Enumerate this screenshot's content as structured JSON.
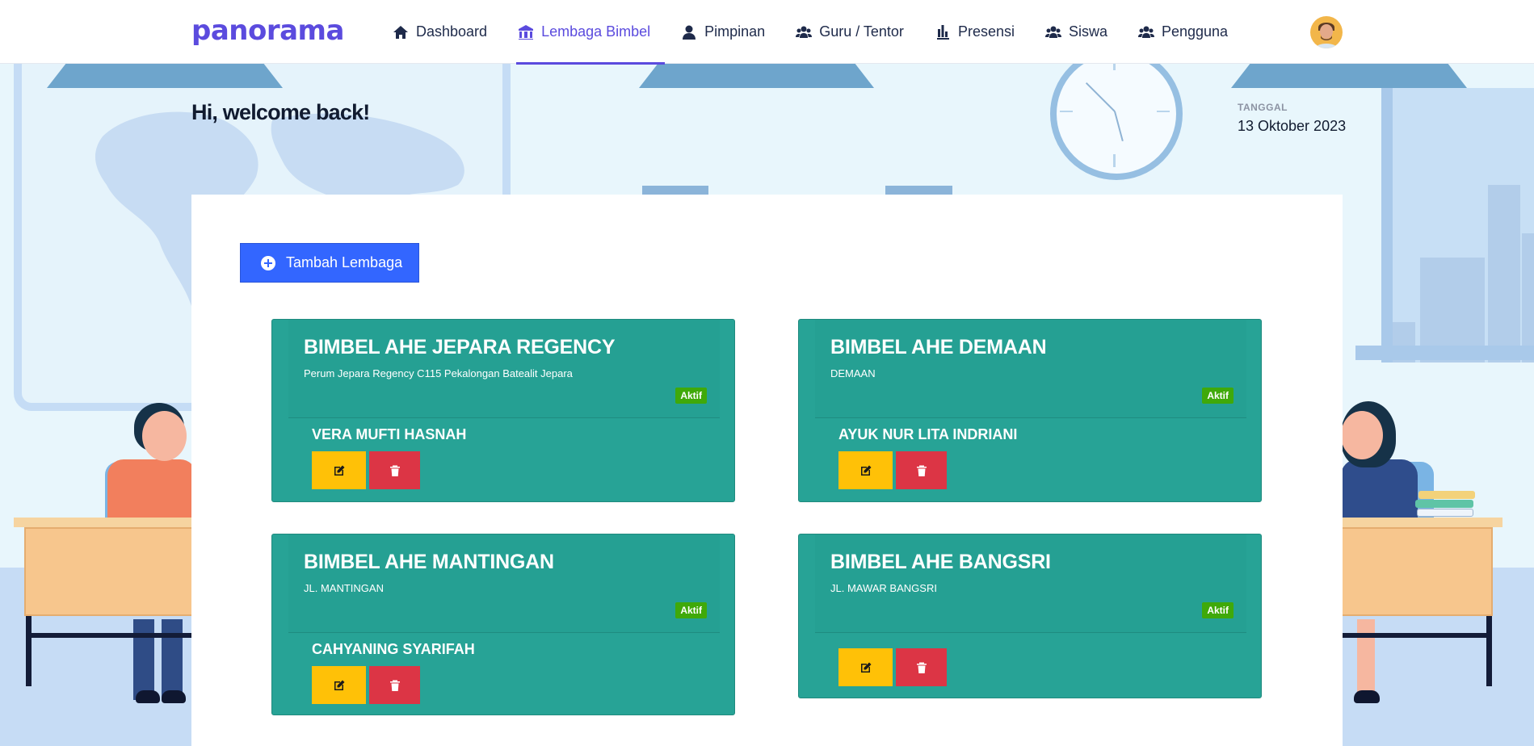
{
  "brand": "panorama",
  "nav": {
    "items": [
      {
        "label": "Dashboard",
        "icon": "home-icon"
      },
      {
        "label": "Lembaga Bimbel",
        "icon": "institution-icon",
        "active": true
      },
      {
        "label": "Pimpinan",
        "icon": "user-icon"
      },
      {
        "label": "Guru / Tentor",
        "icon": "users-icon"
      },
      {
        "label": "Presensi",
        "icon": "attendance-icon"
      },
      {
        "label": "Siswa",
        "icon": "users-icon"
      },
      {
        "label": "Pengguna",
        "icon": "users-icon"
      }
    ]
  },
  "header": {
    "welcome": "Hi, welcome back!",
    "date_label": "TANGGAL",
    "date_value": "13 Oktober 2023"
  },
  "actions": {
    "add_label": "Tambah Lembaga"
  },
  "lembaga": [
    {
      "name": "BIMBEL AHE JEPARA REGENCY",
      "address": "Perum Jepara Regency C115 Pekalongan Batealit Jepara",
      "status": "Aktif",
      "leader": "VERA MUFTI HASNAH"
    },
    {
      "name": "BIMBEL AHE DEMAAN",
      "address": "DEMAAN",
      "status": "Aktif",
      "leader": "AYUK NUR LITA INDRIANI"
    },
    {
      "name": "BIMBEL AHE MANTINGAN",
      "address": "JL. MANTINGAN",
      "status": "Aktif",
      "leader": "CAHYANING SYARIFAH"
    },
    {
      "name": "BIMBEL AHE BANGSRI",
      "address": "JL. MAWAR BANGSRI",
      "status": "Aktif",
      "leader": ""
    }
  ],
  "colors": {
    "brand": "#5b4bde",
    "primary_button": "#3366ff",
    "card": "#27a396",
    "status_active": "#3fa90a",
    "edit_button": "#ffc107",
    "delete_button": "#dc3545"
  }
}
